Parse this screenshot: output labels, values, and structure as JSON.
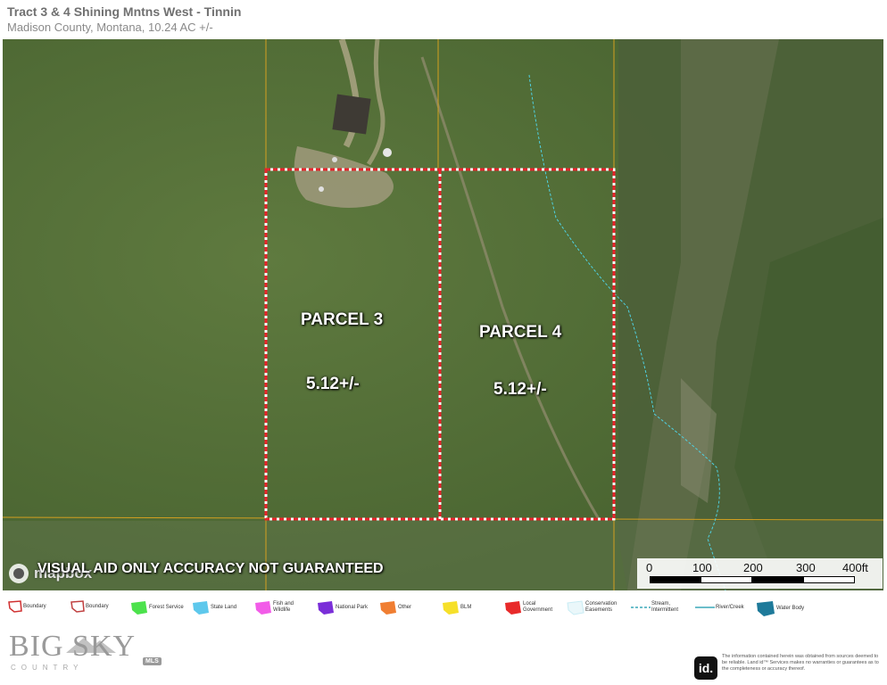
{
  "header": {
    "title": "Tract 3 & 4 Shining Mntns West - Tinnin",
    "subtitle": "Madison County, Montana, 10.24 AC +/-"
  },
  "map": {
    "parcels": [
      {
        "name": "PARCEL 3",
        "area": "5.12+/-"
      },
      {
        "name": "PARCEL 4",
        "area": "5.12+/-"
      }
    ],
    "disclaimer": "VISUAL AID ONLY ACCURACY NOT GUARANTEED",
    "attribution": "mapbox",
    "scale_bar": {
      "ticks": [
        "0",
        "100",
        "200",
        "300",
        "400ft"
      ]
    },
    "colors": {
      "boundary": "#e8242c",
      "section_line": "#d4a020",
      "stream": "#4fd0e0"
    }
  },
  "legend": {
    "items": [
      {
        "label": "Boundary",
        "icon": "boundary-outline-icon",
        "color": "#d03030"
      },
      {
        "label": "Boundary",
        "icon": "boundary-outline-icon",
        "color": "#c04040"
      },
      {
        "label": "Forest Service",
        "icon": "pentagon-icon",
        "color": "#4ce24c"
      },
      {
        "label": "State Land",
        "icon": "pentagon-icon",
        "color": "#5ec8ec"
      },
      {
        "label": "Fish and Wildlife",
        "icon": "pentagon-icon",
        "color": "#f25ce8"
      },
      {
        "label": "National Park",
        "icon": "pentagon-icon",
        "color": "#7a2ed8"
      },
      {
        "label": "Other",
        "icon": "pentagon-icon",
        "color": "#f07e32"
      },
      {
        "label": "BLM",
        "icon": "pentagon-icon",
        "color": "#f6e02a"
      },
      {
        "label": "Local Government",
        "icon": "pentagon-icon",
        "color": "#e82a2a"
      },
      {
        "label": "Conservation Easements",
        "icon": "pentagon-outline-icon",
        "color": "#c8ecf4"
      },
      {
        "label": "Stream, Intermittent",
        "icon": "dashed-line-icon",
        "color": "#3aa8b8"
      },
      {
        "label": "River/Creek",
        "icon": "line-icon",
        "color": "#3aa8b8"
      },
      {
        "label": "Water Body",
        "icon": "pentagon-icon",
        "color": "#1e7a9a"
      }
    ]
  },
  "branding": {
    "logo_text": "BIG SKY",
    "logo_sub": "COUNTRY",
    "logo_badge": "MLS",
    "id_badge": "id.",
    "id_disclaimer": "The information contained herein was obtained from sources deemed to be reliable. Land id™ Services makes no warranties or guarantees as to the completeness or accuracy thereof."
  }
}
